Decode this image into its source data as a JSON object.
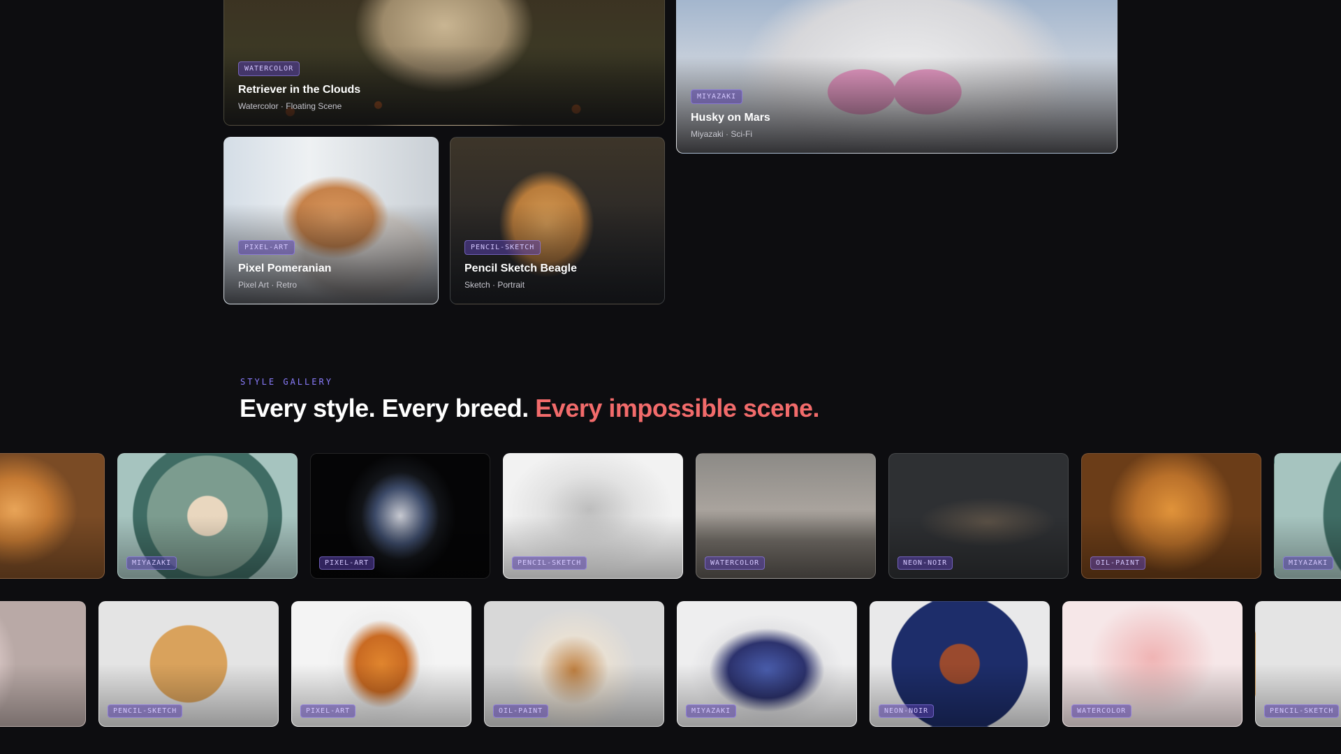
{
  "hero_cards": [
    {
      "badge": "WATERCOLOR",
      "title": "Retriever in the Clouds",
      "subtitle": "Watercolor · Floating Scene"
    },
    {
      "badge": "MIYAZAKI",
      "title": "Husky on Mars",
      "subtitle": "Miyazaki · Sci-Fi"
    },
    {
      "badge": "PIXEL-ART",
      "title": "Pixel Pomeranian",
      "subtitle": "Pixel Art · Retro"
    },
    {
      "badge": "PENCIL-SKETCH",
      "title": "Pencil Sketch Beagle",
      "subtitle": "Sketch · Portrait"
    }
  ],
  "gallery": {
    "eyebrow": "STYLE GALLERY",
    "headline_plain": "Every style. Every breed.",
    "headline_accent": "Every impossible scene.",
    "accent_color": "#f26b6b",
    "row1": [
      {
        "badge": ""
      },
      {
        "badge": "MIYAZAKI"
      },
      {
        "badge": "PIXEL-ART"
      },
      {
        "badge": "PENCIL-SKETCH"
      },
      {
        "badge": "WATERCOLOR"
      },
      {
        "badge": "NEON-NOIR"
      },
      {
        "badge": "OIL-PAINT"
      },
      {
        "badge": "MIYAZAKI"
      }
    ],
    "row2": [
      {
        "badge": ""
      },
      {
        "badge": "PENCIL-SKETCH"
      },
      {
        "badge": "PIXEL-ART"
      },
      {
        "badge": "OIL-PAINT"
      },
      {
        "badge": "MIYAZAKI"
      },
      {
        "badge": "NEON-NOIR"
      },
      {
        "badge": "WATERCOLOR"
      },
      {
        "badge": "PENCIL-SKETCH"
      }
    ]
  }
}
